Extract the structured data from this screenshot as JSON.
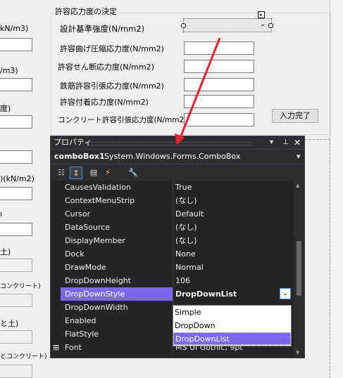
{
  "left_form": {
    "labels": [
      {
        "text": "kN/m3)"
      },
      {
        "text": "/m3)"
      },
      {
        "text": "度)"
      },
      {
        "text": ")(kN/m2)"
      },
      {
        "text": "土)"
      },
      {
        "text": "コンクリート)"
      },
      {
        "text": "と土)"
      },
      {
        "text": "とコンクリート)"
      }
    ]
  },
  "group": {
    "title": "許容応力度の決定",
    "labels": [
      "設計基準強度(N/mm2)",
      "許容曲げ圧縮応力度(N/mm2)",
      "許容せん断応力度(N/mm2)",
      "鉄筋許容引張応力度(N/mm2)",
      "許容付着応力度(N/mm2)",
      "コンクリート許容引張応力度(N/mm2)"
    ],
    "button": "入力完了"
  },
  "properties": {
    "title": "プロパティ",
    "object_name": "comboBox1",
    "object_type": "System.Windows.Forms.ComboBox",
    "rows": [
      {
        "name": "CausesValidation",
        "value": "True"
      },
      {
        "name": "ContextMenuStrip",
        "value": "(なし)"
      },
      {
        "name": "Cursor",
        "value": "Default"
      },
      {
        "name": "DataSource",
        "value": "(なし)"
      },
      {
        "name": "DisplayMember",
        "value": "(なし)"
      },
      {
        "name": "Dock",
        "value": "None"
      },
      {
        "name": "DrawMode",
        "value": "Normal"
      },
      {
        "name": "DropDownHeight",
        "value": "106"
      },
      {
        "name": "DropDownStyle",
        "value": "DropDownList"
      },
      {
        "name": "DropDownWidth",
        "value": ""
      },
      {
        "name": "Enabled",
        "value": ""
      },
      {
        "name": "FlatStyle",
        "value": ""
      },
      {
        "name": "Font",
        "value": "MS UI Gothic, 9pt"
      }
    ],
    "dropdown_options": [
      "Simple",
      "DropDown",
      "DropDownList"
    ],
    "selected_option": "DropDownList"
  },
  "colors": {
    "accent": "#7b68ee",
    "arrow": "#e8202a",
    "dark_bg": "#252526"
  }
}
